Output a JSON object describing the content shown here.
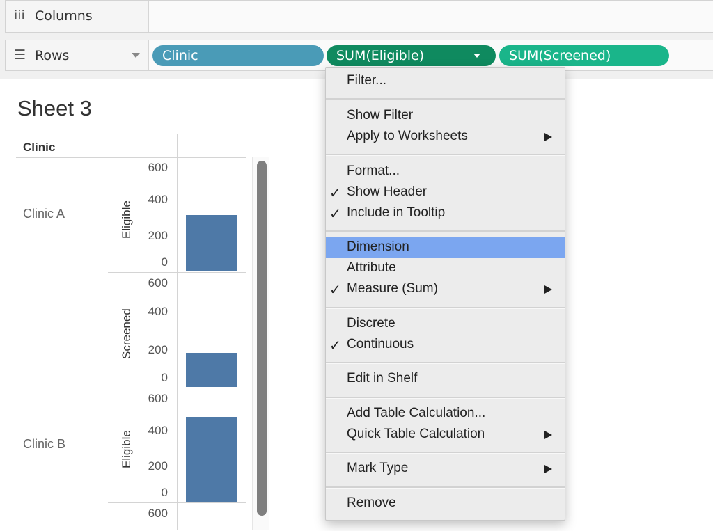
{
  "shelves": {
    "columns": {
      "label": "Columns",
      "icon": "iii"
    },
    "rows": {
      "label": "Rows",
      "icon": "☰"
    }
  },
  "pills": [
    {
      "label": "Clinic",
      "color": "#4a9bb7"
    },
    {
      "label": "SUM(Eligible)",
      "color": "#0f8a5f"
    },
    {
      "label": "SUM(Screened)",
      "color": "#1ab58a"
    }
  ],
  "sheet": {
    "title": "Sheet 3",
    "column_header": "Clinic",
    "clinics": [
      "Clinic A",
      "Clinic B"
    ],
    "measures": [
      "Eligible",
      "Screened",
      "Eligible"
    ]
  },
  "chart_data": {
    "type": "bar",
    "title": "Sheet 3",
    "categories": [
      "Clinic A",
      "Clinic B"
    ],
    "series": [
      {
        "name": "Eligible",
        "values": [
          330,
          500
        ]
      },
      {
        "name": "Screened",
        "values": [
          200,
          null
        ]
      }
    ],
    "ylim": [
      0,
      600
    ],
    "yticks": [
      "600",
      "400",
      "200",
      "0"
    ],
    "bar_color": "#4e79a7"
  },
  "context_menu": {
    "items": [
      {
        "label": "Filter...",
        "checked": false,
        "submenu": false,
        "highlight": false
      },
      {
        "label": "Show Filter",
        "checked": false,
        "submenu": false,
        "highlight": false
      },
      {
        "label": "Apply to Worksheets",
        "checked": false,
        "submenu": true,
        "highlight": false
      },
      {
        "label": "Format...",
        "checked": false,
        "submenu": false,
        "highlight": false
      },
      {
        "label": "Show Header",
        "checked": true,
        "submenu": false,
        "highlight": false
      },
      {
        "label": "Include in Tooltip",
        "checked": true,
        "submenu": false,
        "highlight": false
      },
      {
        "label": "Dimension",
        "checked": false,
        "submenu": false,
        "highlight": true
      },
      {
        "label": "Attribute",
        "checked": false,
        "submenu": false,
        "highlight": false
      },
      {
        "label": "Measure (Sum)",
        "checked": true,
        "submenu": true,
        "highlight": false
      },
      {
        "label": "Discrete",
        "checked": false,
        "submenu": false,
        "highlight": false
      },
      {
        "label": "Continuous",
        "checked": true,
        "submenu": false,
        "highlight": false
      },
      {
        "label": "Edit in Shelf",
        "checked": false,
        "submenu": false,
        "highlight": false
      },
      {
        "label": "Add Table Calculation...",
        "checked": false,
        "submenu": false,
        "highlight": false
      },
      {
        "label": "Quick Table Calculation",
        "checked": false,
        "submenu": true,
        "highlight": false
      },
      {
        "label": "Mark Type",
        "checked": false,
        "submenu": true,
        "highlight": false
      },
      {
        "label": "Remove",
        "checked": false,
        "submenu": false,
        "highlight": false
      }
    ],
    "check_glyph": "✓",
    "highlight_color": "#7ba6f0"
  }
}
